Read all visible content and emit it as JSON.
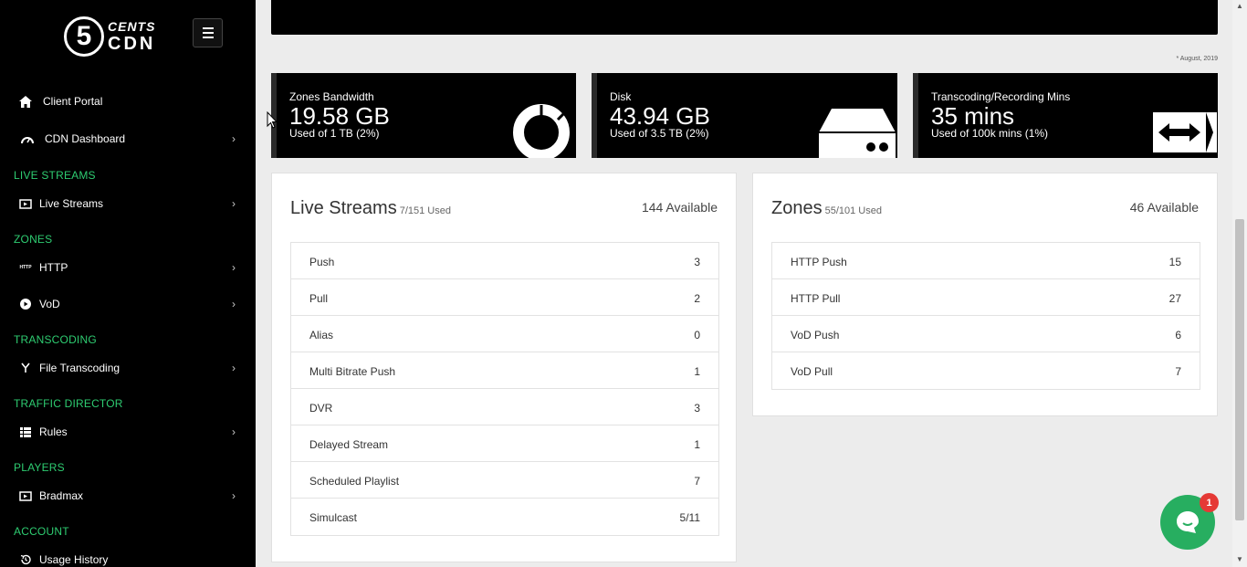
{
  "brand": {
    "logo_digit": "5",
    "logo_line1": "CENTS",
    "logo_line2": "CDN"
  },
  "sidebar": {
    "client_portal": "Client Portal",
    "cdn_dashboard": "CDN Dashboard",
    "sections": {
      "live_streams": "LIVE STREAMS",
      "zones": "ZONES",
      "transcoding": "TRANSCODING",
      "traffic_director": "TRAFFIC DIRECTOR",
      "players": "PLAYERS",
      "account": "ACCOUNT"
    },
    "items": {
      "live_streams": "Live Streams",
      "http": "HTTP",
      "http_icon_text": "HTTP",
      "vod": "VoD",
      "file_transcoding": "File Transcoding",
      "rules": "Rules",
      "bradmax": "Bradmax",
      "usage_history": "Usage History"
    }
  },
  "note": "* August, 2019",
  "stats": {
    "bandwidth": {
      "label": "Zones Bandwidth",
      "value": "19.58 GB",
      "sub": "Used of 1 TB (2%)",
      "icon": "pie-chart-icon"
    },
    "disk": {
      "label": "Disk",
      "value": "43.94 GB",
      "sub": "Used of 3.5 TB (2%)",
      "icon": "hdd-icon"
    },
    "transcoding": {
      "label": "Transcoding/Recording Mins",
      "value": "35 mins",
      "sub": "Used of 100k mins (1%)",
      "icon": "arrows-h-icon"
    }
  },
  "live_streams_panel": {
    "title": "Live Streams",
    "used": "7/151 Used",
    "available": "144 Available",
    "rows": [
      {
        "label": "Push",
        "value": "3"
      },
      {
        "label": "Pull",
        "value": "2"
      },
      {
        "label": "Alias",
        "value": "0"
      },
      {
        "label": "Multi Bitrate Push",
        "value": "1"
      },
      {
        "label": "DVR",
        "value": "3"
      },
      {
        "label": "Delayed Stream",
        "value": "1"
      },
      {
        "label": "Scheduled Playlist",
        "value": "7"
      },
      {
        "label": "Simulcast",
        "value": "5/11"
      }
    ]
  },
  "zones_panel": {
    "title": "Zones",
    "used": "55/101 Used",
    "available": "46 Available",
    "rows": [
      {
        "label": "HTTP Push",
        "value": "15"
      },
      {
        "label": "HTTP Pull",
        "value": "27"
      },
      {
        "label": "VoD Push",
        "value": "6"
      },
      {
        "label": "VoD Pull",
        "value": "7"
      }
    ]
  },
  "chat": {
    "badge": "1"
  },
  "colors": {
    "accent_green": "#2ecc71",
    "chat_green": "#27ae60",
    "badge_red": "#e53935"
  }
}
